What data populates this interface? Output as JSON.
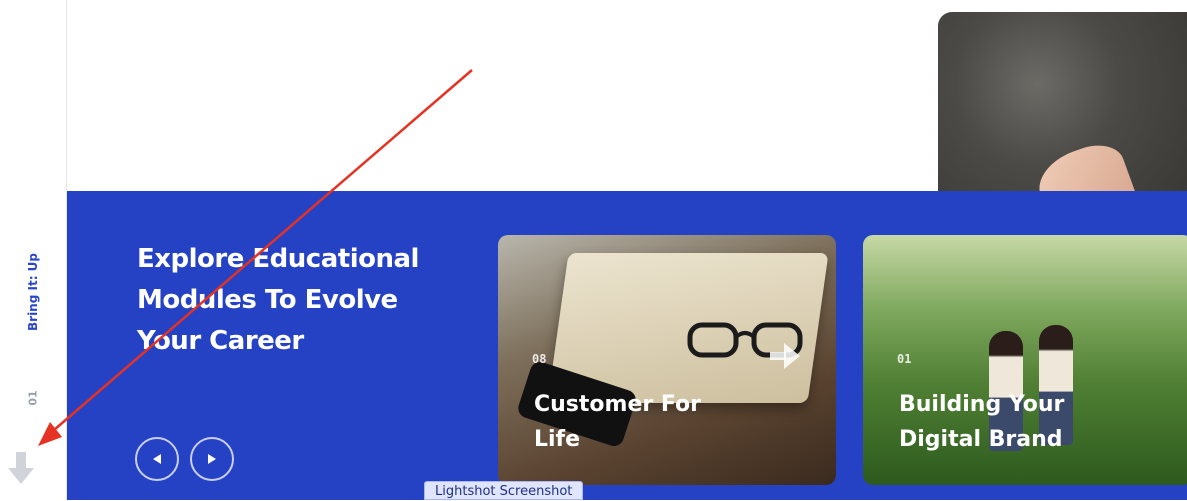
{
  "sidebar": {
    "brand_label": "Bring It: Up",
    "page_number": "01",
    "scroll_icon": "arrow-down-icon"
  },
  "hero": {
    "headline": "Explore Educational Modules To Evolve Your Career",
    "prev_icon": "chevron-left-icon",
    "next_icon": "chevron-right-icon"
  },
  "cards": [
    {
      "number": "08",
      "title": "Customer For Life",
      "icon": "arrow-right-icon"
    },
    {
      "number": "01",
      "title": "Building Your Digital Brand"
    }
  ],
  "tooltip": {
    "label": "Lightshot Screenshot"
  },
  "colors": {
    "primary_blue": "#2542c4",
    "brand_text": "#2b47c9",
    "annotation_red": "#e53222"
  }
}
